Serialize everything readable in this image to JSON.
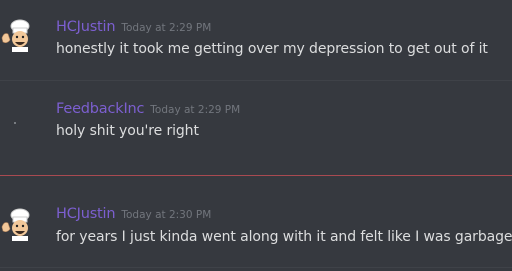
{
  "colors": {
    "background": "#36393f",
    "author_name": "#7c5fd0",
    "message_text": "#dcddde",
    "timestamp": "#72767d",
    "new_messages_divider": "#a94a51"
  },
  "messages": [
    {
      "author": "HCJustin",
      "timestamp": "Today at 2:29 PM",
      "text": "honestly it took me getting over my depression to get out of it",
      "avatar_icon": "chef-avatar-icon"
    },
    {
      "author": "FeedbackInc",
      "timestamp": "Today at 2:29 PM",
      "text": "holy shit you're right",
      "avatar_icon": "blank-avatar-icon"
    },
    {
      "author": "HCJustin",
      "timestamp": "Today at 2:30 PM",
      "text": "for years I just kinda went along with it and felt like I was garbage",
      "avatar_icon": "chef-avatar-icon"
    }
  ]
}
